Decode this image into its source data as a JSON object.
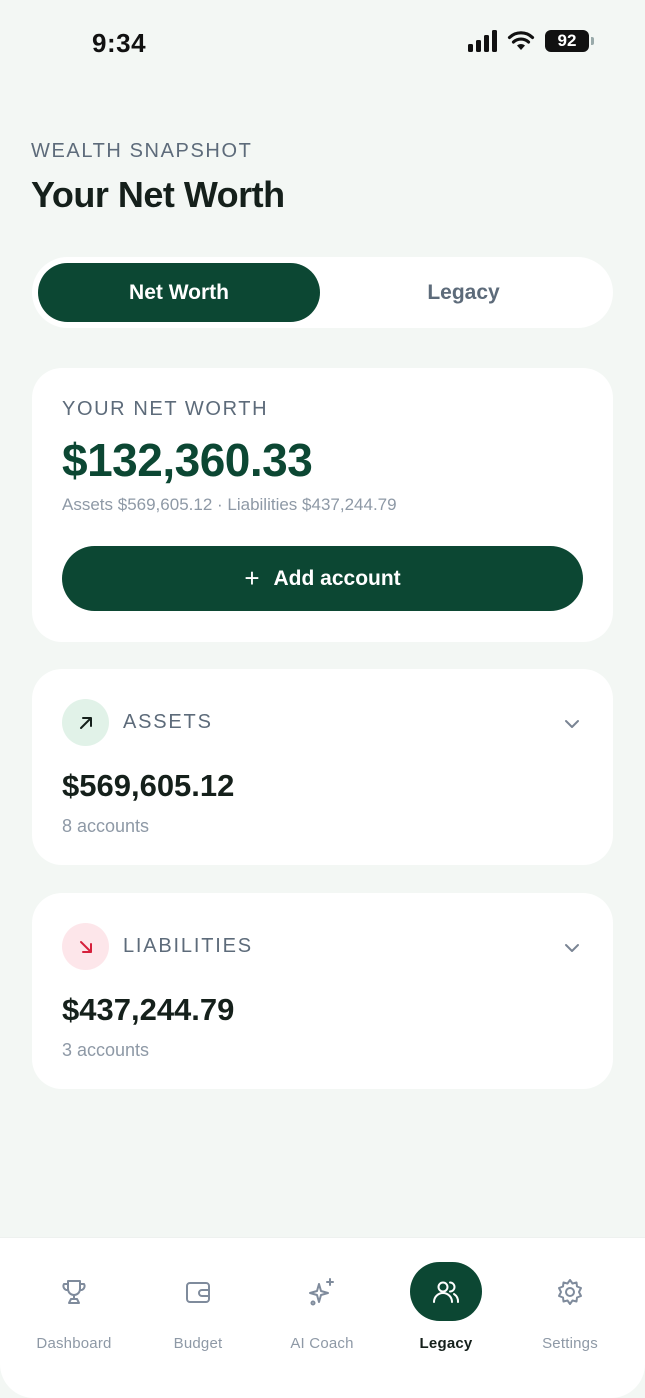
{
  "status": {
    "time": "9:34",
    "battery": "92"
  },
  "header": {
    "eyebrow": "WEALTH SNAPSHOT",
    "title": "Your Net Worth"
  },
  "tabs": [
    {
      "label": "Net Worth",
      "active": true
    },
    {
      "label": "Legacy",
      "active": false
    }
  ],
  "net_worth": {
    "label": "YOUR NET WORTH",
    "value": "$132,360.33",
    "subtitle": "Assets $569,605.12 · Liabilities $437,244.79",
    "add_button": "Add account",
    "add_icon": "+"
  },
  "assets": {
    "title": "ASSETS",
    "value": "$569,605.12",
    "count": "8 accounts",
    "icon": "arrow-up-right-icon",
    "accent": "#e1f2e8"
  },
  "liabilities": {
    "title": "LIABILITIES",
    "value": "$437,244.79",
    "count": "3 accounts",
    "icon": "arrow-down-right-icon",
    "accent": "#fde6ea"
  },
  "nav": [
    {
      "label": "Dashboard",
      "icon": "trophy-icon"
    },
    {
      "label": "Budget",
      "icon": "wallet-icon"
    },
    {
      "label": "AI Coach",
      "icon": "sparkles-icon"
    },
    {
      "label": "Legacy",
      "icon": "users-icon",
      "active": true
    },
    {
      "label": "Settings",
      "icon": "gear-icon"
    }
  ],
  "colors": {
    "brand": "#0c4733",
    "background": "#f3f7f4",
    "liability_accent": "#d6203c"
  }
}
